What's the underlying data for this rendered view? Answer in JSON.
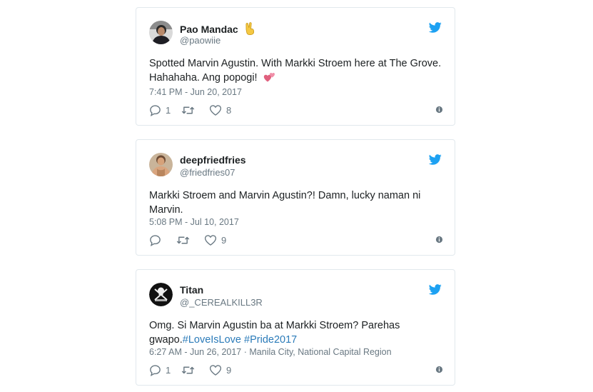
{
  "tweets": [
    {
      "name": "Pao Mandac",
      "name_emoji": "victory-hand-emoji",
      "handle": "@paowiie",
      "text_line1": "Spotted Marvin Agustin. With Markki Stroem here at The Grove.",
      "text_line2": "Hahahaha. Ang popogi!",
      "text_emoji": "two-hearts-emoji",
      "timestamp": "7:41 PM - Jun 20, 2017",
      "replies": "1",
      "retweets": "",
      "likes": "8"
    },
    {
      "name": "deepfriedfries",
      "handle": "@friedfries07",
      "text_line1": "Markki Stroem and Marvin Agustin?! Damn, lucky naman ni",
      "text_line2": "Marvin.",
      "timestamp": "5:08 PM - Jul 10, 2017",
      "replies": "",
      "retweets": "",
      "likes": "9"
    },
    {
      "name": "Titan",
      "handle": "@_CEREALKILL3R",
      "text_line1": "Omg. Si Marvin Agustin ba at Markki Stroem? Parehas",
      "text_line2_plain": "gwapo.",
      "hashtag1": "#LoveIsLove",
      "hashtag2": "#Pride2017",
      "timestamp": "6:27 AM - Jun 26, 2017",
      "location": "· Manila City, National Capital Region",
      "replies": "1",
      "retweets": "",
      "likes": "9"
    }
  ],
  "colors": {
    "twitter_blue": "#1da1f2",
    "meta_gray": "#697882",
    "hashtag_blue": "#2b7bb9",
    "border": "#e1e8ed"
  },
  "icons": [
    "twitter-bird-icon",
    "reply-icon",
    "retweet-icon",
    "like-icon",
    "info-icon"
  ]
}
